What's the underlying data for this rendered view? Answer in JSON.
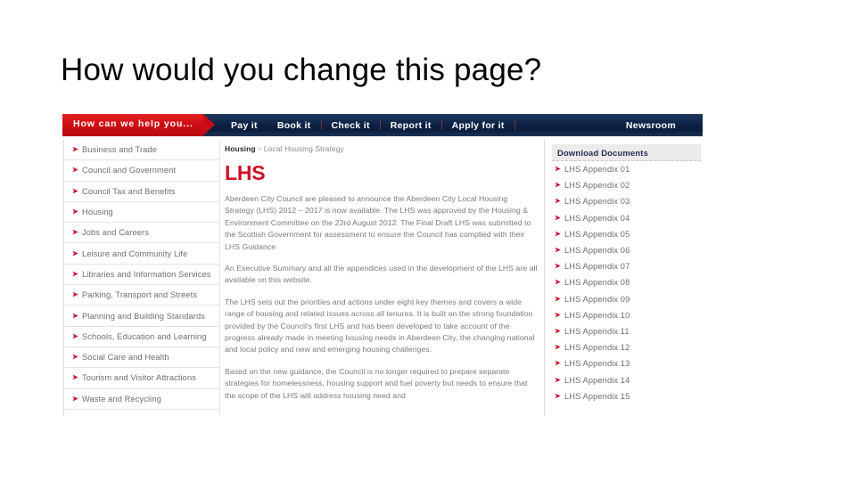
{
  "slide": {
    "title": "How would you change this page?"
  },
  "screenshot": {
    "topbar": {
      "help_tab_label": "How can we help you...",
      "nav_items": [
        {
          "label": "Pay it"
        },
        {
          "label": "Book it"
        },
        {
          "label": "Check it"
        },
        {
          "label": "Report it"
        },
        {
          "label": "Apply for it"
        }
      ],
      "newsroom_label": "Newsroom"
    },
    "left_nav": {
      "items": [
        {
          "label": "Business and Trade"
        },
        {
          "label": "Council and Government"
        },
        {
          "label": "Council Tax and Benefits"
        },
        {
          "label": "Housing"
        },
        {
          "label": "Jobs and Careers"
        },
        {
          "label": "Leisure and Community Life"
        },
        {
          "label": "Libraries and Information Services"
        },
        {
          "label": "Parking, Transport and Streets"
        },
        {
          "label": "Planning and Building Standards"
        },
        {
          "label": "Schools, Education and Learning"
        },
        {
          "label": "Social Care and Health"
        },
        {
          "label": "Tourism and Visitor Attractions"
        },
        {
          "label": "Waste and Recycling"
        }
      ]
    },
    "main": {
      "breadcrumb": {
        "parent": "Housing",
        "separator": ">",
        "current": "Local Housing Strategy"
      },
      "heading": "LHS",
      "paragraphs": [
        "Aberdeen City Council are pleased to announce the Aberdeen City Local Housing Strategy (LHS) 2012 – 2017 is now available. The LHS was approved by the Housing & Environment Committee on the 23rd August 2012. The Final Draft LHS was submitted to the Scottish Government for assessment to ensure the Council has complied with their LHS Guidance.",
        "An Executive Summary and all the appendices used in the development of the LHS are all available on this website.",
        "The LHS sets out the priorities and actions under eight key themes and covers a wide range of housing and related issues across all tenures. It is built on the strong foundation provided by the Council's first LHS and has been developed to take account of the progress already made in meeting housing needs in Aberdeen City, the changing national and local policy and new and emerging housing challenges.",
        "Based on the new guidance, the Council is no longer required to prepare separate strategies for homelessness, housing support and fuel poverty but needs to ensure that the scope of the LHS will address housing need and"
      ]
    },
    "right_column": {
      "header": "Download Documents",
      "items": [
        {
          "label": "LHS Appendix 01"
        },
        {
          "label": "LHS Appendix 02"
        },
        {
          "label": "LHS Appendix 03"
        },
        {
          "label": "LHS Appendix 04"
        },
        {
          "label": "LHS Appendix 05"
        },
        {
          "label": "LHS Appendix 06"
        },
        {
          "label": "LHS Appendix 07"
        },
        {
          "label": "LHS Appendix 08"
        },
        {
          "label": "LHS Appendix 09"
        },
        {
          "label": "LHS Appendix 10"
        },
        {
          "label": "LHS Appendix 11"
        },
        {
          "label": "LHS Appendix 12"
        },
        {
          "label": "LHS Appendix 13"
        },
        {
          "label": "LHS Appendix 14"
        },
        {
          "label": "LHS Appendix 15"
        }
      ]
    },
    "colors": {
      "brand_red": "#cf1126",
      "nav_navy": "#0d2044",
      "text_grey": "#7a7a7e",
      "header_navy": "#1f2b4d"
    }
  }
}
